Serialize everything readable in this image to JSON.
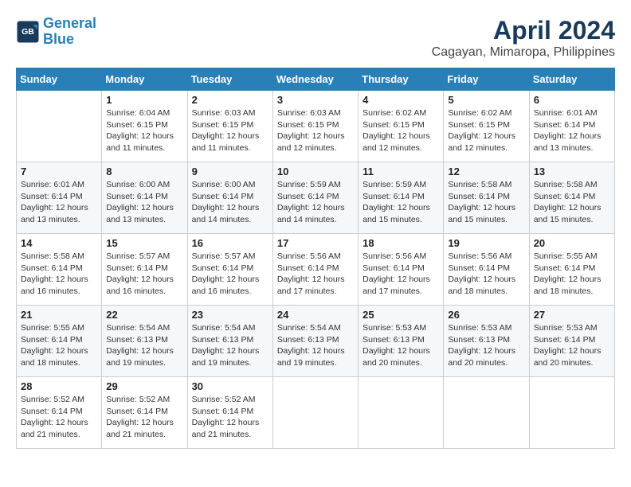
{
  "header": {
    "logo_line1": "General",
    "logo_line2": "Blue",
    "title": "April 2024",
    "subtitle": "Cagayan, Mimaropa, Philippines"
  },
  "days_of_week": [
    "Sunday",
    "Monday",
    "Tuesday",
    "Wednesday",
    "Thursday",
    "Friday",
    "Saturday"
  ],
  "weeks": [
    [
      {
        "day": "",
        "info": ""
      },
      {
        "day": "1",
        "info": "Sunrise: 6:04 AM\nSunset: 6:15 PM\nDaylight: 12 hours\nand 11 minutes."
      },
      {
        "day": "2",
        "info": "Sunrise: 6:03 AM\nSunset: 6:15 PM\nDaylight: 12 hours\nand 11 minutes."
      },
      {
        "day": "3",
        "info": "Sunrise: 6:03 AM\nSunset: 6:15 PM\nDaylight: 12 hours\nand 12 minutes."
      },
      {
        "day": "4",
        "info": "Sunrise: 6:02 AM\nSunset: 6:15 PM\nDaylight: 12 hours\nand 12 minutes."
      },
      {
        "day": "5",
        "info": "Sunrise: 6:02 AM\nSunset: 6:15 PM\nDaylight: 12 hours\nand 12 minutes."
      },
      {
        "day": "6",
        "info": "Sunrise: 6:01 AM\nSunset: 6:14 PM\nDaylight: 12 hours\nand 13 minutes."
      }
    ],
    [
      {
        "day": "7",
        "info": "Sunrise: 6:01 AM\nSunset: 6:14 PM\nDaylight: 12 hours\nand 13 minutes."
      },
      {
        "day": "8",
        "info": "Sunrise: 6:00 AM\nSunset: 6:14 PM\nDaylight: 12 hours\nand 13 minutes."
      },
      {
        "day": "9",
        "info": "Sunrise: 6:00 AM\nSunset: 6:14 PM\nDaylight: 12 hours\nand 14 minutes."
      },
      {
        "day": "10",
        "info": "Sunrise: 5:59 AM\nSunset: 6:14 PM\nDaylight: 12 hours\nand 14 minutes."
      },
      {
        "day": "11",
        "info": "Sunrise: 5:59 AM\nSunset: 6:14 PM\nDaylight: 12 hours\nand 15 minutes."
      },
      {
        "day": "12",
        "info": "Sunrise: 5:58 AM\nSunset: 6:14 PM\nDaylight: 12 hours\nand 15 minutes."
      },
      {
        "day": "13",
        "info": "Sunrise: 5:58 AM\nSunset: 6:14 PM\nDaylight: 12 hours\nand 15 minutes."
      }
    ],
    [
      {
        "day": "14",
        "info": "Sunrise: 5:58 AM\nSunset: 6:14 PM\nDaylight: 12 hours\nand 16 minutes."
      },
      {
        "day": "15",
        "info": "Sunrise: 5:57 AM\nSunset: 6:14 PM\nDaylight: 12 hours\nand 16 minutes."
      },
      {
        "day": "16",
        "info": "Sunrise: 5:57 AM\nSunset: 6:14 PM\nDaylight: 12 hours\nand 16 minutes."
      },
      {
        "day": "17",
        "info": "Sunrise: 5:56 AM\nSunset: 6:14 PM\nDaylight: 12 hours\nand 17 minutes."
      },
      {
        "day": "18",
        "info": "Sunrise: 5:56 AM\nSunset: 6:14 PM\nDaylight: 12 hours\nand 17 minutes."
      },
      {
        "day": "19",
        "info": "Sunrise: 5:56 AM\nSunset: 6:14 PM\nDaylight: 12 hours\nand 18 minutes."
      },
      {
        "day": "20",
        "info": "Sunrise: 5:55 AM\nSunset: 6:14 PM\nDaylight: 12 hours\nand 18 minutes."
      }
    ],
    [
      {
        "day": "21",
        "info": "Sunrise: 5:55 AM\nSunset: 6:14 PM\nDaylight: 12 hours\nand 18 minutes."
      },
      {
        "day": "22",
        "info": "Sunrise: 5:54 AM\nSunset: 6:13 PM\nDaylight: 12 hours\nand 19 minutes."
      },
      {
        "day": "23",
        "info": "Sunrise: 5:54 AM\nSunset: 6:13 PM\nDaylight: 12 hours\nand 19 minutes."
      },
      {
        "day": "24",
        "info": "Sunrise: 5:54 AM\nSunset: 6:13 PM\nDaylight: 12 hours\nand 19 minutes."
      },
      {
        "day": "25",
        "info": "Sunrise: 5:53 AM\nSunset: 6:13 PM\nDaylight: 12 hours\nand 20 minutes."
      },
      {
        "day": "26",
        "info": "Sunrise: 5:53 AM\nSunset: 6:13 PM\nDaylight: 12 hours\nand 20 minutes."
      },
      {
        "day": "27",
        "info": "Sunrise: 5:53 AM\nSunset: 6:14 PM\nDaylight: 12 hours\nand 20 minutes."
      }
    ],
    [
      {
        "day": "28",
        "info": "Sunrise: 5:52 AM\nSunset: 6:14 PM\nDaylight: 12 hours\nand 21 minutes."
      },
      {
        "day": "29",
        "info": "Sunrise: 5:52 AM\nSunset: 6:14 PM\nDaylight: 12 hours\nand 21 minutes."
      },
      {
        "day": "30",
        "info": "Sunrise: 5:52 AM\nSunset: 6:14 PM\nDaylight: 12 hours\nand 21 minutes."
      },
      {
        "day": "",
        "info": ""
      },
      {
        "day": "",
        "info": ""
      },
      {
        "day": "",
        "info": ""
      },
      {
        "day": "",
        "info": ""
      }
    ]
  ]
}
